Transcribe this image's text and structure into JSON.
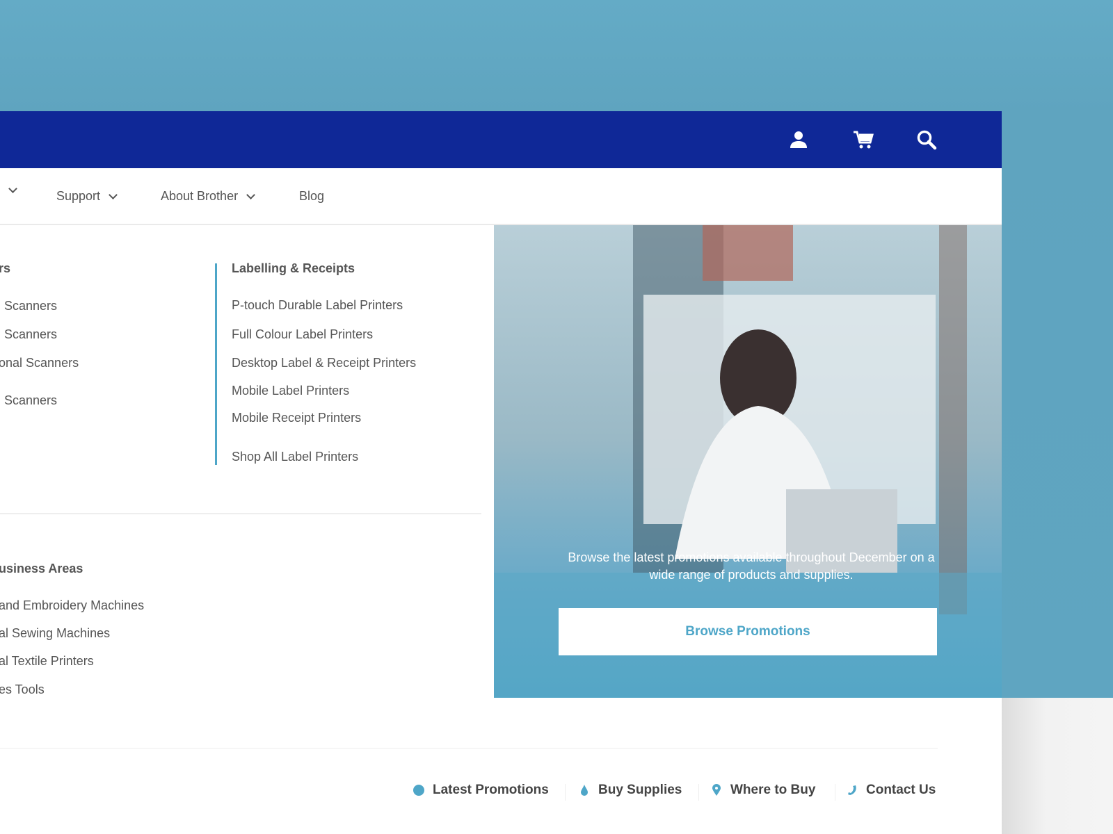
{
  "nav": {
    "items": [
      {
        "label": "Support"
      },
      {
        "label": "About Brother"
      },
      {
        "label": "Blog"
      }
    ]
  },
  "menu": {
    "col1": {
      "heading": "rs",
      "items": [
        "Scanners",
        "Scanners",
        "onal Scanners",
        "Scanners"
      ]
    },
    "col2": {
      "heading": "Labelling & Receipts",
      "items": [
        "P-touch Durable Label Printers",
        "Full Colour Label Printers",
        "Desktop Label & Receipt Printers",
        "Mobile Label Printers",
        "Mobile Receipt Printers",
        "Shop All Label Printers"
      ]
    },
    "col3": {
      "heading": "usiness Areas",
      "items": [
        "and Embroidery Machines",
        "al Sewing Machines",
        "al Textile Printers",
        "es Tools"
      ]
    }
  },
  "promo": {
    "text": "Browse the latest promotions available throughout December on a wide range of products and supplies.",
    "button": "Browse Promotions"
  },
  "footer": {
    "links": [
      {
        "label": "Latest Promotions",
        "icon": "badge-icon"
      },
      {
        "label": "Buy Supplies",
        "icon": "drop-icon"
      },
      {
        "label": "Where to Buy",
        "icon": "map-pin-icon"
      },
      {
        "label": "Contact Us",
        "icon": "phone-icon"
      }
    ]
  },
  "colors": {
    "header": "#0f2897",
    "accent": "#4ea6c8",
    "background": "#62a9c4"
  }
}
